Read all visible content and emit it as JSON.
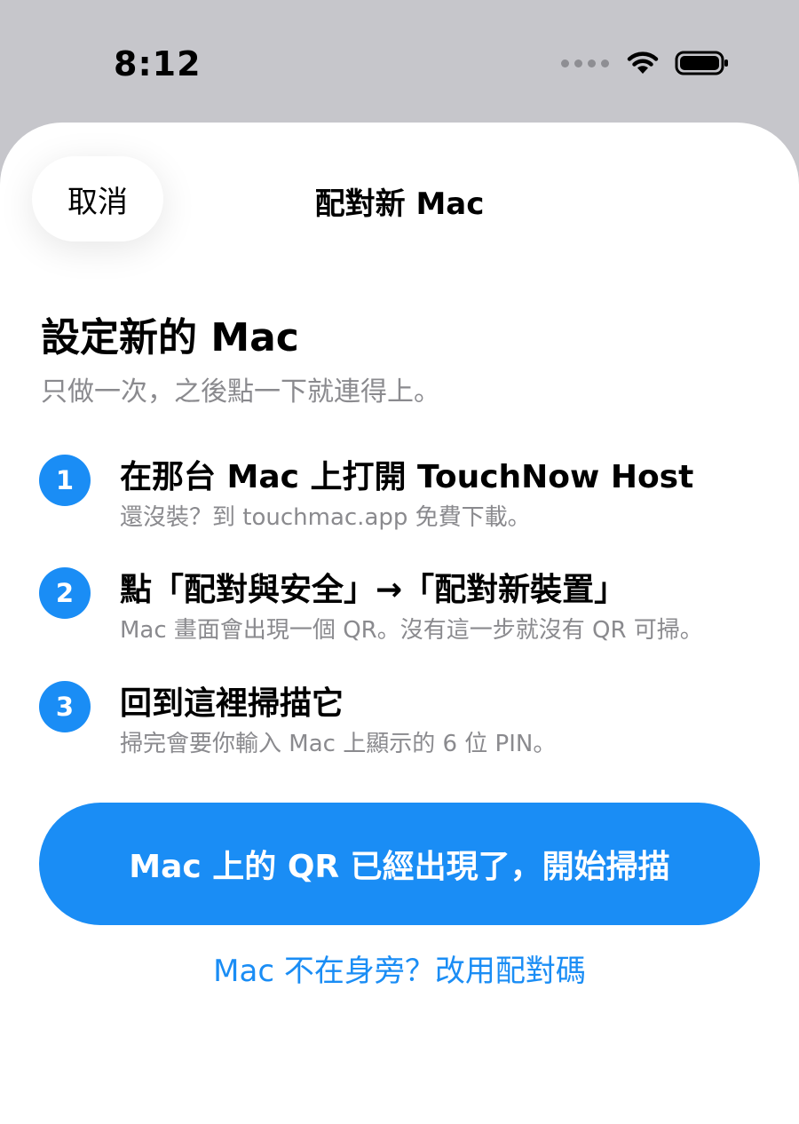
{
  "status_bar": {
    "time": "8:12"
  },
  "nav": {
    "cancel_label": "取消",
    "title": "配對新 Mac"
  },
  "intro": {
    "heading": "設定新的 Mac",
    "subheading": "只做一次，之後點一下就連得上。"
  },
  "steps": [
    {
      "number": "1",
      "title": "在那台 Mac 上打開 TouchNow Host",
      "description": "還沒裝？到 touchmac.app 免費下載。"
    },
    {
      "number": "2",
      "title": "點「配對與安全」→「配對新裝置」",
      "description": "Mac 畫面會出現一個 QR。沒有這一步就沒有 QR 可掃。"
    },
    {
      "number": "3",
      "title": "回到這裡掃描它",
      "description": "掃完會要你輸入 Mac 上顯示的 6 位 PIN。"
    }
  ],
  "actions": {
    "primary_label": "Mac 上的 QR 已經出現了，開始掃描",
    "secondary_label": "Mac 不在身旁？改用配對碼"
  },
  "colors": {
    "accent": "#1a8df5",
    "secondary_text": "#8a8a8e",
    "status_bar_bg": "#c6c6cb"
  }
}
